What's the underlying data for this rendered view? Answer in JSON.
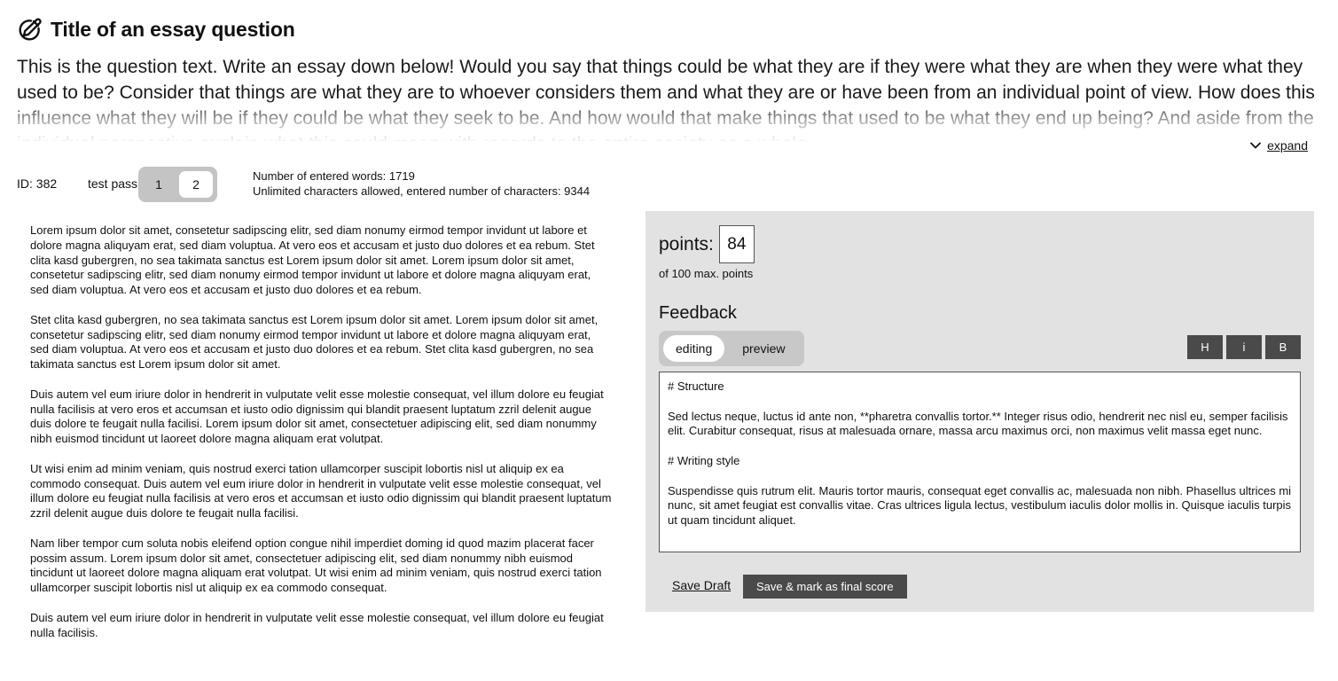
{
  "question": {
    "title": "Title of an essay question",
    "text": "This is the question text. Write an essay down below! Would you say that things could be what they are if they were what they are when they were what they used to be? Consider that things are what they are to whoever considers them and what they are or have been from an individual point of view. How does this influence what they will be if they could be what they seek to be. And how would that make things that used to be what they end up being? And aside from the individual perspective explain what this could mean with regards to the entire society as a whole.",
    "expand_label": "expand",
    "title_icon": "pen-edit-icon",
    "expand_icon": "chevron-down-icon"
  },
  "meta": {
    "id_label": "ID: 382",
    "test_pass_label": "test pass",
    "passes": [
      "1",
      "2"
    ],
    "selected_pass": "2",
    "word_count_text": "Number of entered words: 1719",
    "char_count_text": "Unlimited characters allowed, entered number of characters: 9344"
  },
  "essay": {
    "paragraphs": [
      "Lorem ipsum dolor sit amet, consetetur sadipscing elitr, sed diam nonumy eirmod tempor invidunt ut labore et dolore magna aliquyam erat, sed diam voluptua. At vero eos et accusam et justo duo dolores et ea rebum. Stet clita kasd gubergren, no sea takimata sanctus est Lorem ipsum dolor sit amet. Lorem ipsum dolor sit amet, consetetur sadipscing elitr, sed diam nonumy eirmod tempor invidunt ut labore et dolore magna aliquyam erat, sed diam voluptua. At vero eos et accusam et justo duo dolores et ea rebum.",
      "Stet clita kasd gubergren, no sea takimata sanctus est Lorem ipsum dolor sit amet. Lorem ipsum dolor sit amet, consetetur sadipscing elitr, sed diam nonumy eirmod tempor invidunt ut labore et dolore magna aliquyam erat, sed diam voluptua. At vero eos et accusam et justo duo dolores et ea rebum. Stet clita kasd gubergren, no sea takimata sanctus est Lorem ipsum dolor sit amet.",
      "Duis autem vel eum iriure dolor in hendrerit in vulputate velit esse molestie consequat, vel illum dolore eu feugiat nulla facilisis at vero eros et accumsan et iusto odio dignissim qui blandit praesent luptatum zzril delenit augue duis dolore te feugait nulla facilisi. Lorem ipsum dolor sit amet, consectetuer adipiscing elit, sed diam nonummy nibh euismod tincidunt ut laoreet dolore magna aliquam erat volutpat.",
      "Ut wisi enim ad minim veniam, quis nostrud exerci tation ullamcorper suscipit lobortis nisl ut aliquip ex ea commodo consequat. Duis autem vel eum iriure dolor in hendrerit in vulputate velit esse molestie consequat, vel illum dolore eu feugiat nulla facilisis at vero eros et accumsan et iusto odio dignissim qui blandit praesent luptatum zzril delenit augue duis dolore te feugait nulla facilisi.",
      "Nam liber tempor cum soluta nobis eleifend option congue nihil imperdiet doming id quod mazim placerat facer possim assum. Lorem ipsum dolor sit amet, consectetuer adipiscing elit, sed diam nonummy nibh euismod tincidunt ut laoreet dolore magna aliquam erat volutpat. Ut wisi enim ad minim veniam, quis nostrud exerci tation ullamcorper suscipit lobortis nisl ut aliquip ex ea commodo consequat.",
      "Duis autem vel eum iriure dolor in hendrerit in vulputate velit esse molestie consequat, vel illum dolore eu feugiat nulla facilisis."
    ]
  },
  "grading": {
    "points_label": "points:",
    "points_value": "84",
    "max_points_text": "of 100 max. points",
    "feedback_title": "Feedback",
    "modes": [
      "editing",
      "preview"
    ],
    "selected_mode": "editing",
    "format_buttons": [
      "H",
      "i",
      "B"
    ],
    "feedback_text": "# Structure\n\nSed lectus neque, luctus id ante non, **pharetra convallis tortor.** Integer risus odio, hendrerit nec nisl eu, semper facilisis elit. Curabitur consequat, risus at malesuada ornare, massa arcu maximus orci, non maximus velit massa eget nunc.\n\n# Writing style\n\nSuspendisse quis rutrum elit. Mauris tortor mauris, consequat eget convallis ac, malesuada non nibh. Phasellus ultrices mi nunc, sit amet feugiat est convallis vitae. Cras ultrices ligula lectus, vestibulum iaculis dolor mollis in. Quisque iaculis turpis ut quam tincidunt aliquet.",
    "save_draft_label": "Save Draft",
    "save_final_label": "Save & mark as final score"
  }
}
